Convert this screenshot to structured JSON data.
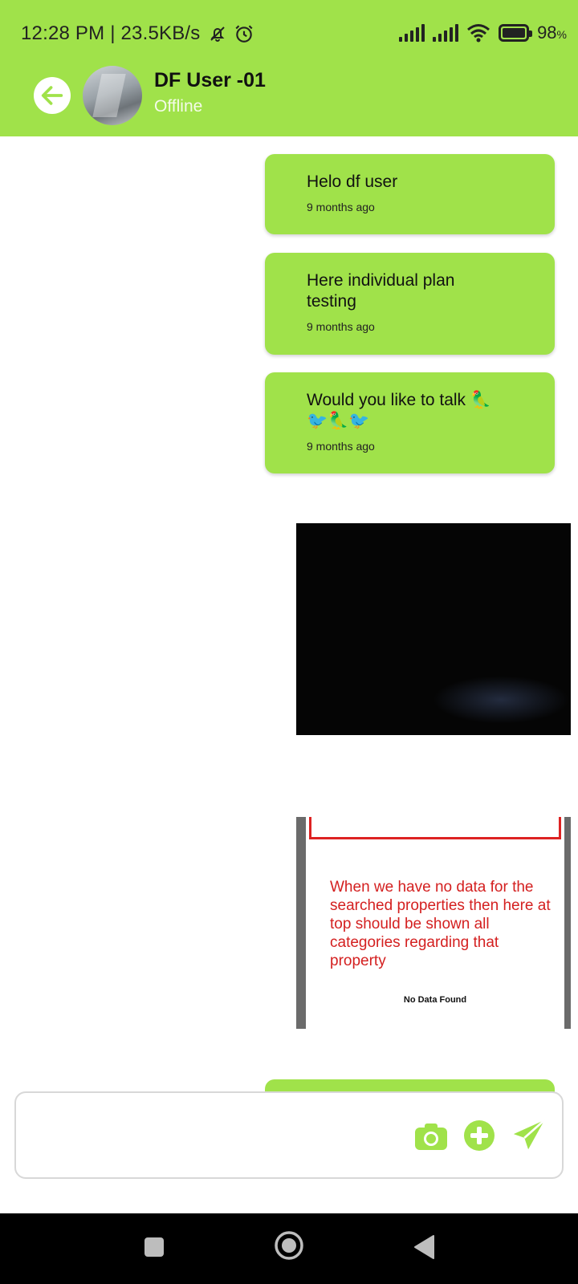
{
  "status_bar": {
    "time_speed": "12:28 PM | 23.5KB/s",
    "battery": "98",
    "battery_unit": "%"
  },
  "header": {
    "contact_name": "DF User -01",
    "contact_status": "Offline"
  },
  "messages": [
    {
      "text": "Helo df user",
      "time": "9 months ago"
    },
    {
      "text": "Here individual plan testing",
      "time": "9 months ago"
    },
    {
      "text": "Would you like to talk 🦜 🐦🦜🐦",
      "time": "9 months ago"
    }
  ],
  "image_messages": [
    {
      "kind": "dark photo"
    },
    {
      "note_text": "When we have no data for the searched properties then here at top should be shown all categories regarding that property",
      "footer_text": "No Data Found"
    }
  ],
  "composer": {
    "placeholder": ""
  },
  "colors": {
    "accent": "#a0e24a",
    "header": "#a0e24a",
    "nav_bar": "#000000",
    "note_red": "#d42020"
  },
  "icons": [
    "back-arrow-icon",
    "camera-icon",
    "add-circle-icon",
    "send-icon",
    "recents-square-icon",
    "home-circle-icon",
    "back-triangle-icon"
  ]
}
